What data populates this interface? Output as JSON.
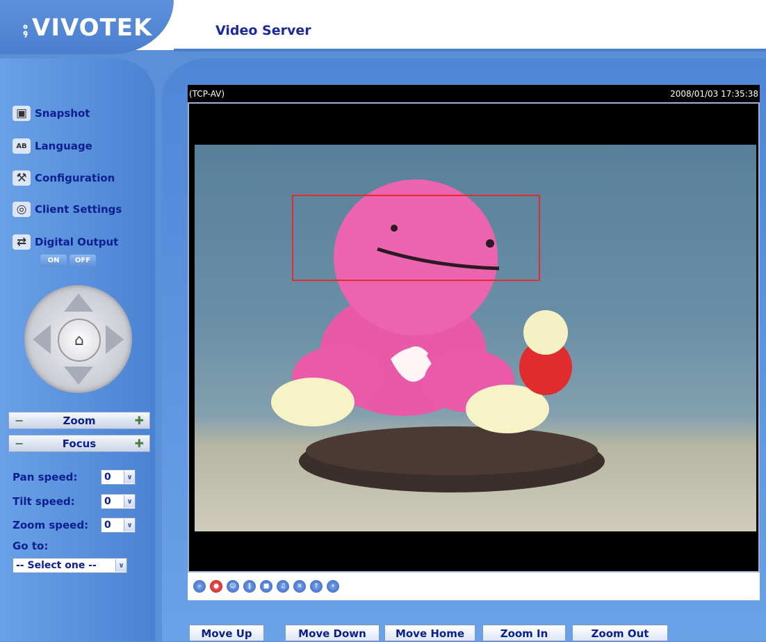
{
  "brand": {
    "logo_text": "VIVOTEK",
    "title": "Video Server"
  },
  "menu": {
    "snapshot": "Snapshot",
    "language": "Language",
    "configuration": "Configuration",
    "client_settings": "Client Settings",
    "digital_output": "Digital Output",
    "on": "ON",
    "off": "OFF"
  },
  "ptz": {
    "zoom_label": "Zoom",
    "focus_label": "Focus"
  },
  "speeds": {
    "pan_label": "Pan speed:",
    "pan_value": "0",
    "tilt_label": "Tilt speed:",
    "tilt_value": "0",
    "zoom_label": "Zoom speed:",
    "zoom_value": "0",
    "goto_label": "Go to:",
    "goto_value": "-- Select one --"
  },
  "video": {
    "stream": "(TCP-AV)",
    "timestamp": "2008/01/03 17:35:38"
  },
  "buttons": {
    "move_up": "Move Up",
    "move_down": "Move Down",
    "move_home": "Move Home",
    "zoom_in": "Zoom In",
    "zoom_out": "Zoom Out"
  }
}
